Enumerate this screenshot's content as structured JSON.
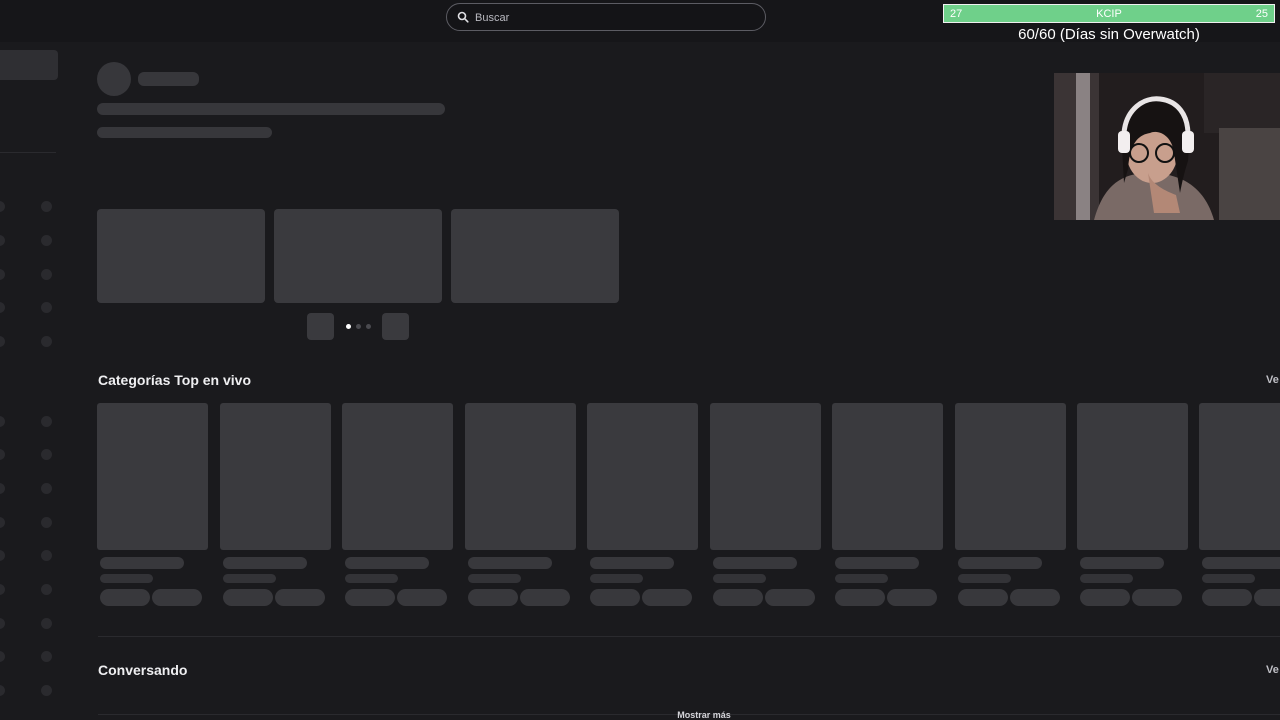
{
  "search": {
    "placeholder": "Buscar"
  },
  "overlay": {
    "goal_left": "27",
    "goal_label": "KCIP",
    "goal_right": "25",
    "goal_color": "#6fd08a",
    "counter_text": "60/60 (Días sin Overwatch)"
  },
  "carousel": {
    "page_count": 3,
    "active_page": 1
  },
  "sections": {
    "top_categories": {
      "title": "Categorías Top en vivo",
      "see_all": "Ve"
    },
    "conversando": {
      "title": "Conversando",
      "see_all": "Ve"
    }
  },
  "show_more": "Mostrar más",
  "colors": {
    "background": "#1a1a1d",
    "skeleton": "#3a3a3e",
    "accent_goal": "#6fd08a"
  }
}
